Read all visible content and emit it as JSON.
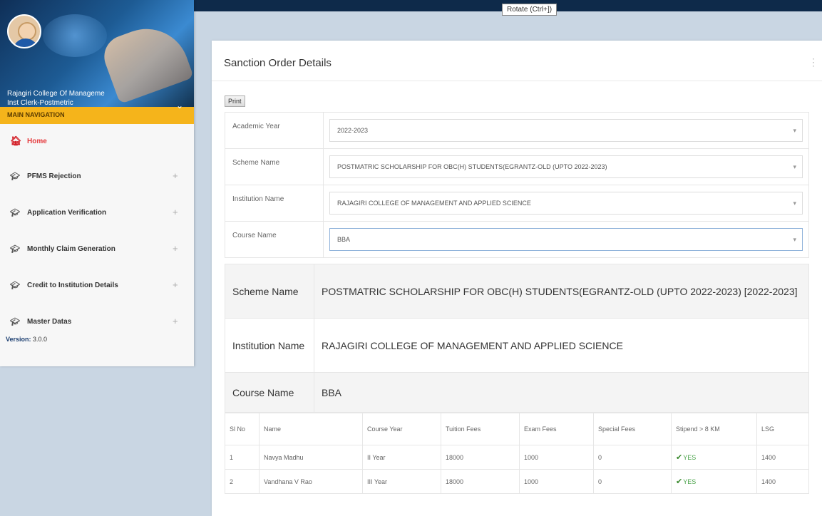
{
  "tooltip": "Rotate (Ctrl+])",
  "sidebar": {
    "org_name": "Rajagiri College Of Manageme",
    "role": "Inst Clerk-Postmetric",
    "main_nav_label": "MAIN NAVIGATION",
    "items": [
      {
        "label": "Home",
        "icon": "home-icon",
        "active": true
      },
      {
        "label": "PFMS Rejection",
        "icon": "graduation-cap-icon"
      },
      {
        "label": "Application Verification",
        "icon": "graduation-cap-icon"
      },
      {
        "label": "Monthly Claim Generation",
        "icon": "graduation-cap-icon"
      },
      {
        "label": "Credit to Institution Details",
        "icon": "graduation-cap-icon"
      },
      {
        "label": "Master Datas",
        "icon": "graduation-cap-icon"
      }
    ],
    "version_label": "Version:",
    "version_value": "3.0.0"
  },
  "panel": {
    "title": "Sanction Order Details",
    "print_label": "Print"
  },
  "form": {
    "academic_year_label": "Academic Year",
    "academic_year": "2022-2023",
    "scheme_name_label": "Scheme Name",
    "scheme_name": "POSTMATRIC SCHOLARSHIP FOR OBC(H) STUDENTS(EGRANTZ-OLD (UPTO 2022-2023)",
    "institution_name_label": "Institution Name",
    "institution_name": "RAJAGIRI COLLEGE OF MANAGEMENT AND APPLIED SCIENCE",
    "course_name_label": "Course Name",
    "course_name": "BBA"
  },
  "summary": {
    "scheme_label": "Scheme Name",
    "scheme_value": "POSTMATRIC SCHOLARSHIP FOR OBC(H) STUDENTS(EGRANTZ-OLD (UPTO 2022-2023) [2022-2023]",
    "institution_label": "Institution Name",
    "institution_value": "RAJAGIRI COLLEGE OF MANAGEMENT AND APPLIED SCIENCE",
    "course_label": "Course Name",
    "course_value": "BBA"
  },
  "table": {
    "headers": [
      "Sl No",
      "Name",
      "Course Year",
      "Tuition Fees",
      "Exam Fees",
      "Special Fees",
      "Stipend > 8 KM",
      "LSG"
    ],
    "rows": [
      [
        "1",
        "Navya Madhu",
        "II Year",
        "18000",
        "1000",
        "0",
        "YES",
        "1400"
      ],
      [
        "2",
        "Vandhana V Rao",
        "III Year",
        "18000",
        "1000",
        "0",
        "YES",
        "1400"
      ]
    ]
  }
}
